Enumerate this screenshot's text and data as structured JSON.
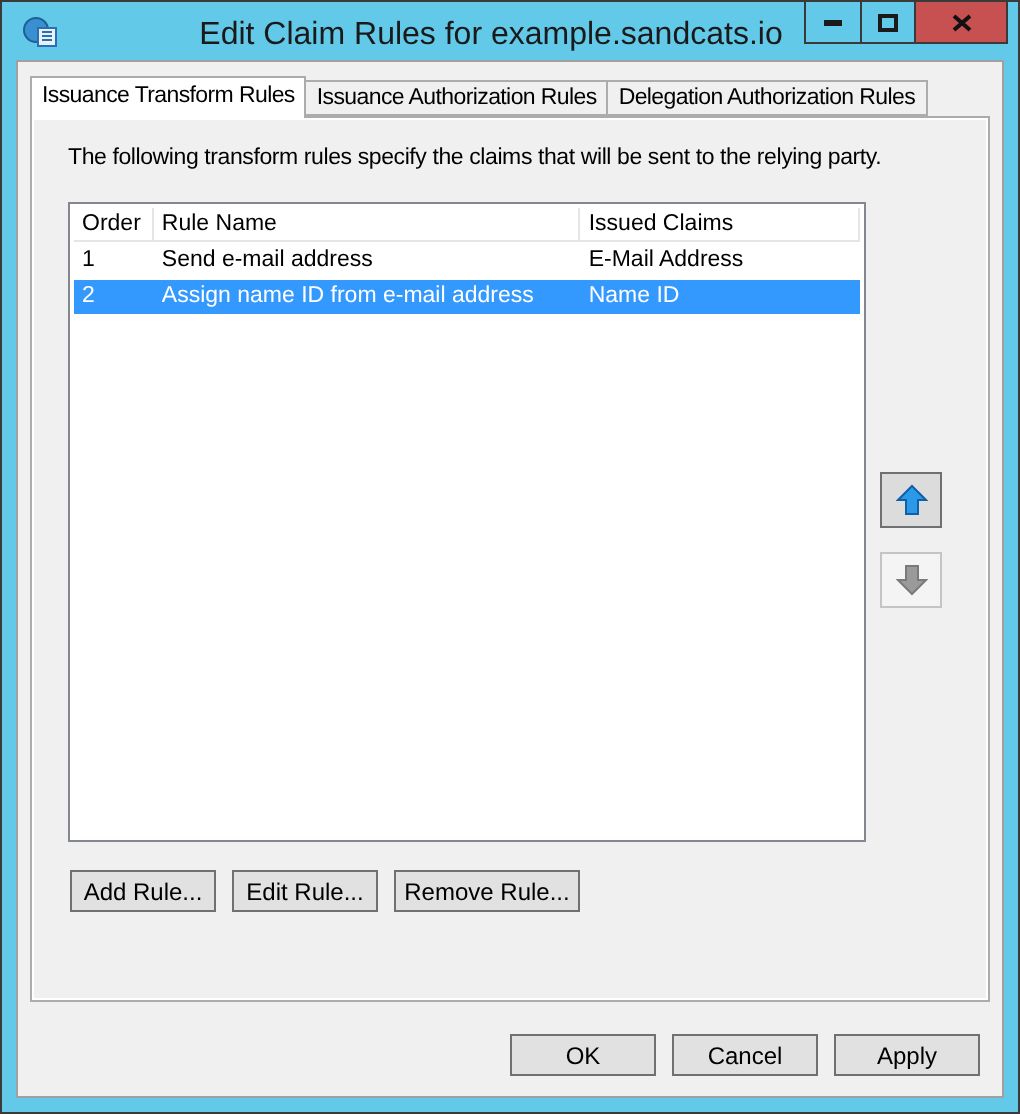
{
  "window": {
    "title": "Edit Claim Rules for example.sandcats.io"
  },
  "tabs": [
    {
      "label": "Issuance Transform Rules",
      "selected": true
    },
    {
      "label": "Issuance Authorization Rules",
      "selected": false
    },
    {
      "label": "Delegation Authorization Rules",
      "selected": false
    }
  ],
  "description": "The following transform rules specify the claims that will be sent to the relying party.",
  "table": {
    "columns": [
      "Order",
      "Rule Name",
      "Issued Claims"
    ],
    "rows": [
      {
        "cells": [
          "1",
          "Send e-mail address",
          "E-Mail Address"
        ],
        "selected": false
      },
      {
        "cells": [
          "2",
          "Assign name ID from e-mail address",
          "Name ID"
        ],
        "selected": true
      }
    ]
  },
  "move_buttons": [
    {
      "kind": "up",
      "disabled": false
    },
    {
      "kind": "down",
      "disabled": true
    }
  ],
  "rule_buttons": [
    "Add Rule...",
    "Edit Rule...",
    "Remove Rule..."
  ],
  "dialog_buttons": [
    "OK",
    "Cancel",
    "Apply"
  ]
}
